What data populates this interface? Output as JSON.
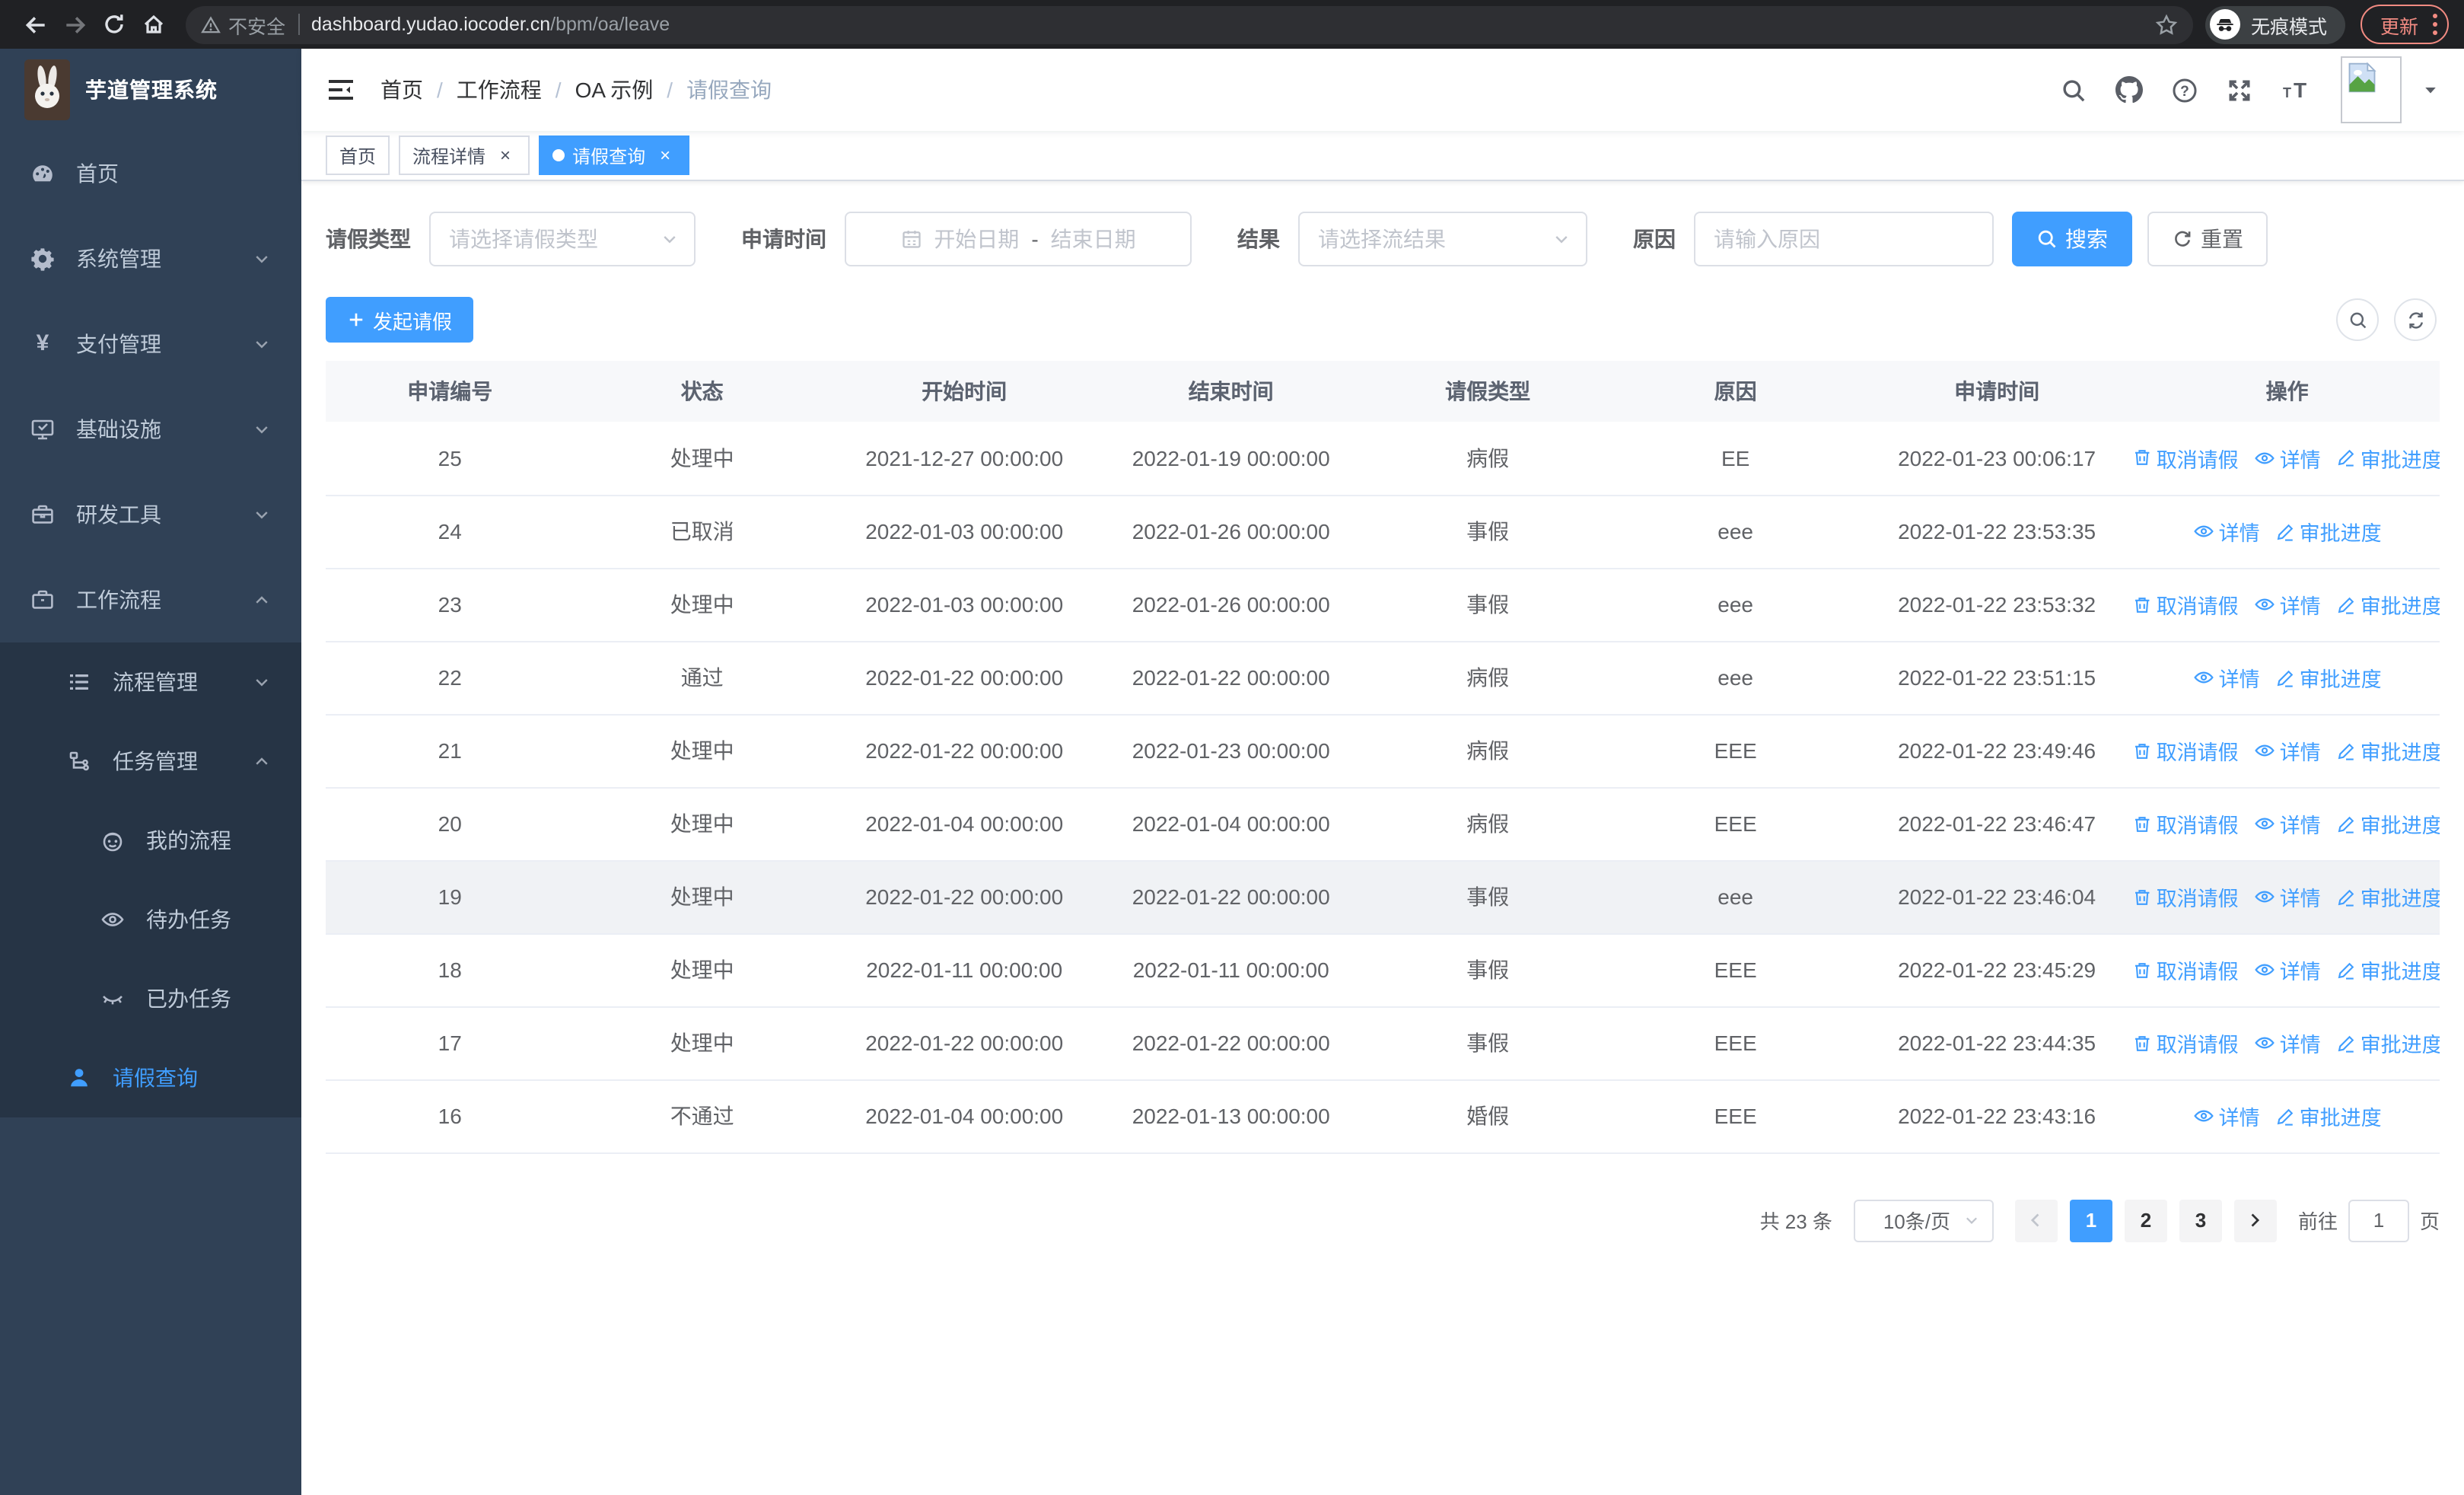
{
  "browser": {
    "security_label": "不安全",
    "url_host": "dashboard.yudao.iocoder.cn",
    "url_path": "/bpm/oa/leave",
    "incognito_label": "无痕模式",
    "update_label": "更新"
  },
  "sidebar": {
    "logo_title": "芋道管理系统",
    "menu": [
      {
        "label": "首页",
        "icon": "dashboard-icon",
        "level": 1
      },
      {
        "label": "系统管理",
        "icon": "gear-icon",
        "level": 1,
        "arrow": "down"
      },
      {
        "label": "支付管理",
        "icon": "yen-icon",
        "level": 1,
        "arrow": "down"
      },
      {
        "label": "基础设施",
        "icon": "monitor-icon",
        "level": 1,
        "arrow": "down"
      },
      {
        "label": "研发工具",
        "icon": "toolbox-icon",
        "level": 1,
        "arrow": "down"
      },
      {
        "label": "工作流程",
        "icon": "briefcase-icon",
        "level": 1,
        "arrow": "up"
      },
      {
        "label": "流程管理",
        "icon": "list-icon",
        "level": 2,
        "arrow": "down",
        "submenu": true
      },
      {
        "label": "任务管理",
        "icon": "tree-icon",
        "level": 2,
        "arrow": "up",
        "submenu": true
      },
      {
        "label": "我的流程",
        "icon": "face-icon",
        "level": 3,
        "submenu": true
      },
      {
        "label": "待办任务",
        "icon": "eye-open-icon",
        "level": 3,
        "submenu": true
      },
      {
        "label": "已办任务",
        "icon": "eye-close-icon",
        "level": 3,
        "submenu": true
      },
      {
        "label": "请假查询",
        "icon": "person-icon",
        "level": 2,
        "submenu": true,
        "active": true
      }
    ]
  },
  "navbar": {
    "breadcrumb": [
      {
        "label": "首页"
      },
      {
        "label": "工作流程"
      },
      {
        "label": "OA 示例"
      },
      {
        "label": "请假查询",
        "current": true
      }
    ]
  },
  "tabs": [
    {
      "label": "首页",
      "closable": false,
      "active": false
    },
    {
      "label": "流程详情",
      "closable": true,
      "active": false
    },
    {
      "label": "请假查询",
      "closable": true,
      "active": true
    }
  ],
  "filters": {
    "leave_type": {
      "label": "请假类型",
      "placeholder": "请选择请假类型"
    },
    "apply_time": {
      "label": "申请时间",
      "start_placeholder": "开始日期",
      "separator": "-",
      "end_placeholder": "结束日期"
    },
    "result": {
      "label": "结果",
      "placeholder": "请选择流结果"
    },
    "reason": {
      "label": "原因",
      "placeholder": "请输入原因"
    },
    "search_label": "搜索",
    "reset_label": "重置"
  },
  "toolbar": {
    "create_label": "发起请假"
  },
  "table": {
    "headers": [
      "申请编号",
      "状态",
      "开始时间",
      "结束时间",
      "请假类型",
      "原因",
      "申请时间",
      "操作"
    ],
    "rows": [
      {
        "id": "25",
        "status": "处理中",
        "start_time": "2021-12-27 00:00:00",
        "end_time": "2022-01-19 00:00:00",
        "leave_type": "病假",
        "reason": "EE",
        "apply_time": "2022-01-23 00:06:17",
        "highlighted": false,
        "actions": [
          {
            "label": "取消请假",
            "icon": "delete-icon"
          },
          {
            "label": "详情",
            "icon": "view-icon"
          },
          {
            "label": "审批进度",
            "icon": "edit-icon"
          }
        ]
      },
      {
        "id": "24",
        "status": "已取消",
        "start_time": "2022-01-03 00:00:00",
        "end_time": "2022-01-26 00:00:00",
        "leave_type": "事假",
        "reason": "eee",
        "apply_time": "2022-01-22 23:53:35",
        "highlighted": false,
        "actions": [
          {
            "label": "详情",
            "icon": "view-icon"
          },
          {
            "label": "审批进度",
            "icon": "edit-icon"
          }
        ]
      },
      {
        "id": "23",
        "status": "处理中",
        "start_time": "2022-01-03 00:00:00",
        "end_time": "2022-01-26 00:00:00",
        "leave_type": "事假",
        "reason": "eee",
        "apply_time": "2022-01-22 23:53:32",
        "highlighted": false,
        "actions": [
          {
            "label": "取消请假",
            "icon": "delete-icon"
          },
          {
            "label": "详情",
            "icon": "view-icon"
          },
          {
            "label": "审批进度",
            "icon": "edit-icon"
          }
        ]
      },
      {
        "id": "22",
        "status": "通过",
        "start_time": "2022-01-22 00:00:00",
        "end_time": "2022-01-22 00:00:00",
        "leave_type": "病假",
        "reason": "eee",
        "apply_time": "2022-01-22 23:51:15",
        "highlighted": false,
        "actions": [
          {
            "label": "详情",
            "icon": "view-icon"
          },
          {
            "label": "审批进度",
            "icon": "edit-icon"
          }
        ]
      },
      {
        "id": "21",
        "status": "处理中",
        "start_time": "2022-01-22 00:00:00",
        "end_time": "2022-01-23 00:00:00",
        "leave_type": "病假",
        "reason": "EEE",
        "apply_time": "2022-01-22 23:49:46",
        "highlighted": false,
        "actions": [
          {
            "label": "取消请假",
            "icon": "delete-icon"
          },
          {
            "label": "详情",
            "icon": "view-icon"
          },
          {
            "label": "审批进度",
            "icon": "edit-icon"
          }
        ]
      },
      {
        "id": "20",
        "status": "处理中",
        "start_time": "2022-01-04 00:00:00",
        "end_time": "2022-01-04 00:00:00",
        "leave_type": "病假",
        "reason": "EEE",
        "apply_time": "2022-01-22 23:46:47",
        "highlighted": false,
        "actions": [
          {
            "label": "取消请假",
            "icon": "delete-icon"
          },
          {
            "label": "详情",
            "icon": "view-icon"
          },
          {
            "label": "审批进度",
            "icon": "edit-icon"
          }
        ]
      },
      {
        "id": "19",
        "status": "处理中",
        "start_time": "2022-01-22 00:00:00",
        "end_time": "2022-01-22 00:00:00",
        "leave_type": "事假",
        "reason": "eee",
        "apply_time": "2022-01-22 23:46:04",
        "highlighted": true,
        "actions": [
          {
            "label": "取消请假",
            "icon": "delete-icon"
          },
          {
            "label": "详情",
            "icon": "view-icon"
          },
          {
            "label": "审批进度",
            "icon": "edit-icon"
          }
        ]
      },
      {
        "id": "18",
        "status": "处理中",
        "start_time": "2022-01-11 00:00:00",
        "end_time": "2022-01-11 00:00:00",
        "leave_type": "事假",
        "reason": "EEE",
        "apply_time": "2022-01-22 23:45:29",
        "highlighted": false,
        "actions": [
          {
            "label": "取消请假",
            "icon": "delete-icon"
          },
          {
            "label": "详情",
            "icon": "view-icon"
          },
          {
            "label": "审批进度",
            "icon": "edit-icon"
          }
        ]
      },
      {
        "id": "17",
        "status": "处理中",
        "start_time": "2022-01-22 00:00:00",
        "end_time": "2022-01-22 00:00:00",
        "leave_type": "事假",
        "reason": "EEE",
        "apply_time": "2022-01-22 23:44:35",
        "highlighted": false,
        "actions": [
          {
            "label": "取消请假",
            "icon": "delete-icon"
          },
          {
            "label": "详情",
            "icon": "view-icon"
          },
          {
            "label": "审批进度",
            "icon": "edit-icon"
          }
        ]
      },
      {
        "id": "16",
        "status": "不通过",
        "start_time": "2022-01-04 00:00:00",
        "end_time": "2022-01-13 00:00:00",
        "leave_type": "婚假",
        "reason": "EEE",
        "apply_time": "2022-01-22 23:43:16",
        "highlighted": false,
        "actions": [
          {
            "label": "详情",
            "icon": "view-icon"
          },
          {
            "label": "审批进度",
            "icon": "edit-icon"
          }
        ]
      }
    ]
  },
  "pagination": {
    "total_text": "共 23 条",
    "page_size": "10条/页",
    "pages": [
      "1",
      "2",
      "3"
    ],
    "active_page": "1",
    "prev_enabled": false,
    "next_enabled": true,
    "goto_label": "前往",
    "goto_value": "1",
    "goto_suffix": "页"
  },
  "colors": {
    "primary": "#409eff",
    "sidebar_bg": "#304156",
    "submenu_bg": "#263445",
    "menu_text": "#bfcbd9",
    "chrome_bar": "#202124",
    "update_accent": "#f28b82",
    "table_border": "#ebeef5",
    "header_bg": "#f7f8fa"
  }
}
